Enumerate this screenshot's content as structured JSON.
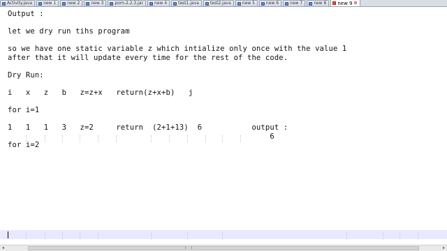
{
  "tabs": [
    {
      "label": "Activity.java",
      "active": false
    },
    {
      "label": "new 1",
      "active": false
    },
    {
      "label": "new 2",
      "active": false
    },
    {
      "label": "new 3",
      "active": false
    },
    {
      "label": "pom-2.2.3.jar",
      "active": false
    },
    {
      "label": "new 4",
      "active": false
    },
    {
      "label": "test1.java",
      "active": false
    },
    {
      "label": "test2.java",
      "active": false
    },
    {
      "label": "new 5",
      "active": false
    },
    {
      "label": "new 6",
      "active": false
    },
    {
      "label": "new 7",
      "active": false
    },
    {
      "label": "new 8",
      "active": false
    },
    {
      "label": "new 9",
      "active": true
    }
  ],
  "editor_lines": [
    "Output :",
    "",
    "let we dry run tihs program",
    "",
    "so we have one static variable z which intialize only once with the value 1",
    "after that it will update every time for the rest of the code.",
    "",
    "Dry Run:",
    "",
    "i   x   z   b   z=z+x   return(z+x+b)   j",
    "",
    "for i=1",
    "",
    "1   1   1   3   z=2     return  (2+1+13)  6           output :",
    "                                                          6",
    "for i=2"
  ],
  "colors": {
    "tab_active_icon": "#e44c3a",
    "current_line_highlight": "#e8e8ff"
  }
}
